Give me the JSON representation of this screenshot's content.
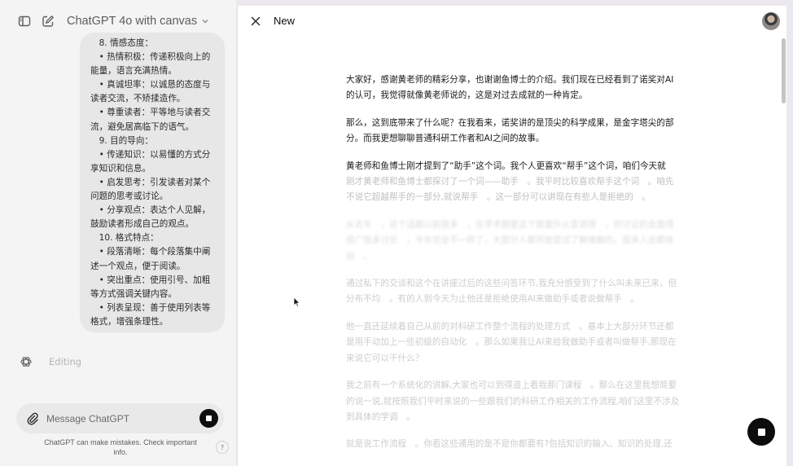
{
  "header": {
    "model_title": "ChatGPT 4o with canvas"
  },
  "chat": {
    "bubble_lines": [
      "　8. 情感态度：",
      "　• 热情积极：传递积极向上的能量，语言充满热情。",
      "　• 真诚坦率：以诚恳的态度与读者交流，不矫揉造作。",
      "　• 尊重读者：平等地与读者交流，避免居高临下的语气。",
      "　9. 目的导向：",
      "　• 传递知识：以易懂的方式分享知识和信息。",
      "　• 启发思考：引发读者对某个问题的思考或讨论。",
      "　• 分享观点：表达个人见解，鼓励读者形成自己的观点。",
      "　10. 格式特点：",
      "　• 段落清晰：每个段落集中阐述一个观点，便于阅读。",
      "　• 突出重点：使用引号、加粗等方式强调关键内容。",
      "　• 列表呈现：善于使用列表等格式，增强条理性。"
    ],
    "status_text": "Editing"
  },
  "composer": {
    "placeholder": "Message ChatGPT",
    "disclaimer": "ChatGPT can make mistakes. Check important info.",
    "help_label": "?"
  },
  "canvas": {
    "title": "New",
    "paragraphs": [
      "大家好，感谢黄老师的精彩分享，也谢谢鱼博士的介绍。我们现在已经看到了诺奖对AI的认可，我觉得就像黄老师说的，这是对过去成就的一种肯定。",
      "那么，这到底带来了什么呢？在我看来，诺奖讲的是顶尖的科学成果，是金字塔尖的部分。而我更想聊聊普通科研工作者和AI之间的故事。",
      "黄老师和鱼博士刚才提到了“助手”这个词。我个人更喜欢“帮手”这个词，咱们今天就",
      "刚才黄老师和鱼博士都探讨了一个词——助手　。我平时比较喜欢帮手这个词　。咱先不说它超越帮手的一部分,就说帮手　。这一部分可以讲现在有些人是拒绝的　。",
      "从去年　，这个话题以前很多　，在学术圈里这个就要升火变调得　，你讨论的会面得很广很多讨论　，今年完全不一样了，大部分人都开始尝试了解接触的，很多人还都体验　。",
      "通过私下的交谈和这个在讲座过后的这些问答环节,我充分感受到了什么叫未来已来，但分布不均　。有的人到今天为止他还是拒绝使用AI来做助手或者说做帮手　。",
      "他一直还延续着自己从前的对科研工作整个流程的处理方式　。基本上大部分环节还都是用手动加上一些初级的自动化　。那么如果我让AI来给我做助手或者叫做帮手,那现在来说它可以干什么？",
      "我之前有一个系统化的讲解,大家也可以到得道上看我那门课程　。那么在这里我想简要的说一说,就按照我们平时来说的一些跟我们的科研工作相关的工作流程,咱们这里不涉及到具体的学调　。",
      "就是说工作流程　。你看这些通用的是不是你都要有?包括知识的输入、知识的处理,还"
    ]
  },
  "colors": {
    "sidebar_bg": "#f4f4f4",
    "bubble_bg": "#e7e7e7",
    "canvas_bg": "#ffffff",
    "stop_button": "#0d0d0d"
  }
}
